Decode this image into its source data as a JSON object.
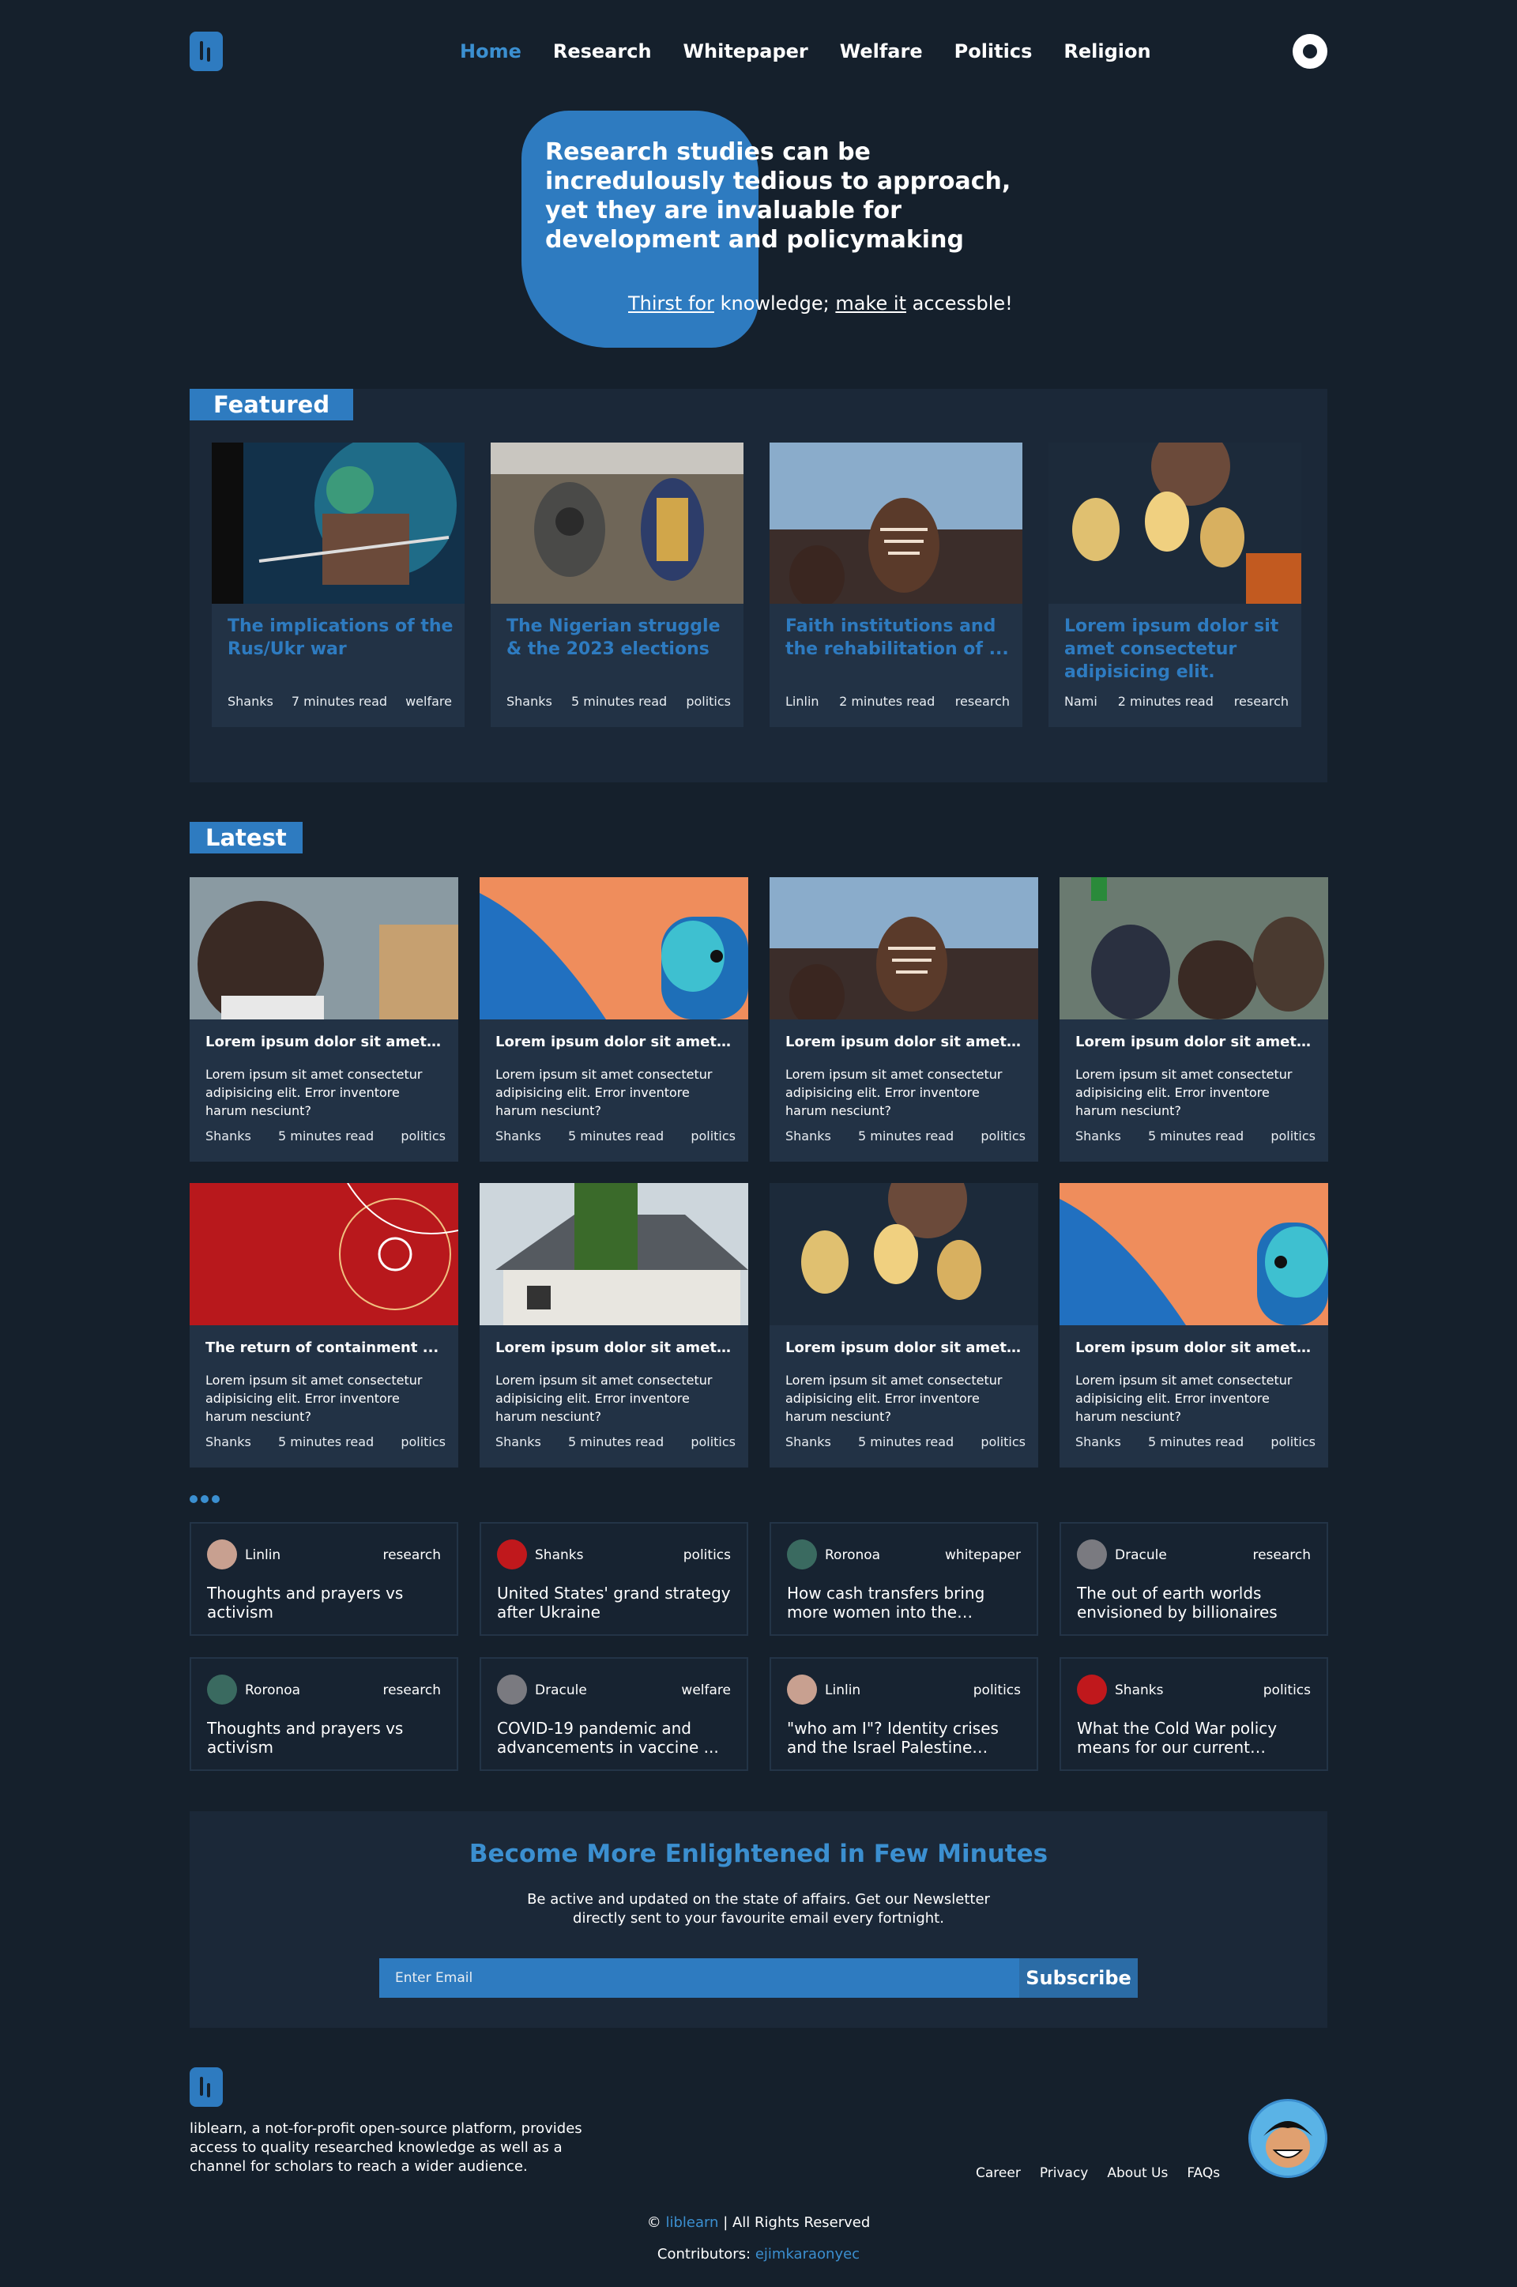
{
  "nav": {
    "items": [
      {
        "label": "Home",
        "active": true
      },
      {
        "label": "Research"
      },
      {
        "label": "Whitepaper"
      },
      {
        "label": "Welfare"
      },
      {
        "label": "Politics"
      },
      {
        "label": "Religion"
      }
    ]
  },
  "hero": {
    "title": "Research studies can be incredulously tedious to approach, yet they are invaluable for development and policymaking",
    "sub_a": "Thirst for",
    "sub_b": " knowledge; ",
    "sub_c": "make it",
    "sub_d": " accessble!"
  },
  "featured": {
    "title": "Featured",
    "cards": [
      {
        "title": "The implications of the Rus/Ukr war",
        "author": "Shanks",
        "read": "7 minutes read",
        "category": "welfare"
      },
      {
        "title": "The Nigerian struggle & the 2023 elections",
        "author": "Shanks",
        "read": "5 minutes read",
        "category": "politics"
      },
      {
        "title": "Faith institutions and the rehabilitation of ...",
        "author": "Linlin",
        "read": "2 minutes read",
        "category": "research"
      },
      {
        "title": "Lorem ipsum dolor sit amet consectetur adipisicing elit.",
        "author": "Nami",
        "read": "2 minutes read",
        "category": "research"
      }
    ]
  },
  "latest": {
    "title": "Latest",
    "cards": [
      {
        "title": "Lorem ipsum dolor sit amet...",
        "body": "Lorem ipsum sit amet consectetur adipisicing elit. Error inventore harum nesciunt?",
        "author": "Shanks",
        "read": "5 minutes read",
        "category": "politics"
      },
      {
        "title": "Lorem ipsum dolor sit amet...",
        "body": "Lorem ipsum sit amet consectetur adipisicing elit. Error inventore harum nesciunt?",
        "author": "Shanks",
        "read": "5 minutes read",
        "category": "politics"
      },
      {
        "title": "Lorem ipsum dolor sit amet...",
        "body": "Lorem ipsum sit amet consectetur adipisicing elit. Error inventore harum nesciunt?",
        "author": "Shanks",
        "read": "5 minutes read",
        "category": "politics"
      },
      {
        "title": "Lorem ipsum dolor sit amet...",
        "body": "Lorem ipsum sit amet consectetur adipisicing elit. Error inventore harum nesciunt?",
        "author": "Shanks",
        "read": "5 minutes read",
        "category": "politics"
      },
      {
        "title": "The return of containment ...",
        "body": "Lorem ipsum sit amet consectetur adipisicing elit. Error inventore harum nesciunt?",
        "author": "Shanks",
        "read": "5 minutes read",
        "category": "politics"
      },
      {
        "title": "Lorem ipsum dolor sit amet...",
        "body": "Lorem ipsum sit amet consectetur adipisicing elit. Error inventore harum nesciunt?",
        "author": "Shanks",
        "read": "5 minutes read",
        "category": "politics"
      },
      {
        "title": "Lorem ipsum dolor sit amet...",
        "body": "Lorem ipsum sit amet consectetur adipisicing elit. Error inventore harum nesciunt?",
        "author": "Shanks",
        "read": "5 minutes read",
        "category": "politics"
      },
      {
        "title": "Lorem ipsum dolor sit amet...",
        "body": "Lorem ipsum sit amet consectetur adipisicing elit. Error inventore harum nesciunt?",
        "author": "Shanks",
        "read": "5 minutes read",
        "category": "politics"
      }
    ]
  },
  "small_posts": [
    {
      "author": "Linlin",
      "category": "research",
      "title": "Thoughts and prayers vs activism"
    },
    {
      "author": "Shanks",
      "category": "politics",
      "title": "United States' grand strategy after Ukraine"
    },
    {
      "author": "Roronoa",
      "category": "whitepaper",
      "title": "How cash transfers bring more women into the workforce"
    },
    {
      "author": "Dracule",
      "category": "research",
      "title": "The out of earth worlds envisioned by billionaires"
    },
    {
      "author": "Roronoa",
      "category": "research",
      "title": "Thoughts and prayers vs activism"
    },
    {
      "author": "Dracule",
      "category": "welfare",
      "title": "COVID-19 pandemic and advancements in vaccine ..."
    },
    {
      "author": "Linlin",
      "category": "politics",
      "title": "\"who am I\"? Identity crises and the Israel Palestine conflict"
    },
    {
      "author": "Shanks",
      "category": "politics",
      "title": "What the Cold War policy means for our current moment."
    }
  ],
  "newsletter": {
    "title": "Become More Enlightened in Few Minutes",
    "description": "Be active and updated on the state of affairs. Get our Newsletter directly sent to your favourite email every fortnight.",
    "placeholder": "Enter Email",
    "button": "Subscribe"
  },
  "footer": {
    "about": "liblearn, a not-for-profit open-source platform, provides access to quality researched knowledge as well as a channel for scholars to reach a wider audience.",
    "links": [
      "Career",
      "Privacy",
      "About Us",
      "FAQs"
    ],
    "copy_symbol": "©",
    "brand": "liblearn",
    "copy_rest": " | All Rights Reserved",
    "contrib_label": "Contributors: ",
    "contrib_name": "ejimkaraonyec"
  },
  "colors": {
    "background": "#15202c",
    "accent": "#2e7bc0",
    "card": "#223245"
  }
}
